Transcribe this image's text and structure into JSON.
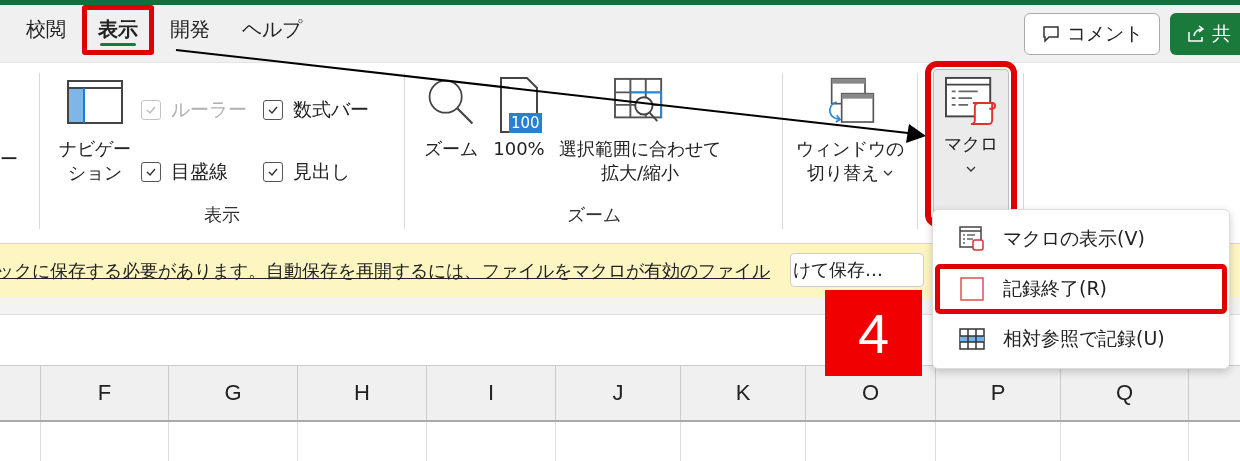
{
  "tabs": [
    {
      "label": "校閲",
      "selected": false,
      "highlighted": false
    },
    {
      "label": "表示",
      "selected": true,
      "highlighted": true
    },
    {
      "label": "開発",
      "selected": false,
      "highlighted": false
    },
    {
      "label": "ヘルプ",
      "selected": false,
      "highlighted": false
    }
  ],
  "header_buttons": [
    {
      "kind": "comment",
      "label": "コメント"
    },
    {
      "kind": "share",
      "label": "共"
    }
  ],
  "ribbon": {
    "cut_label": "ー",
    "show_group": {
      "label": "表示",
      "navigation": {
        "label_lines": [
          "ナビゲー",
          "ション"
        ]
      },
      "checkboxes": [
        {
          "label": "ルーラー",
          "checked": true,
          "disabled": true
        },
        {
          "label": "数式バー",
          "checked": true,
          "disabled": false
        },
        {
          "label": "目盛線",
          "checked": true,
          "disabled": false
        },
        {
          "label": "見出し",
          "checked": true,
          "disabled": false
        }
      ]
    },
    "zoom_group": {
      "label": "ズーム",
      "buttons": [
        {
          "kind": "zoom",
          "label_lines": [
            "ズーム"
          ]
        },
        {
          "kind": "hundred",
          "icon_text": "100",
          "label_lines": [
            "100%"
          ]
        },
        {
          "kind": "fit",
          "label_lines": [
            "選択範囲に合わせて",
            "拡大/縮小"
          ]
        }
      ]
    },
    "window_switch": {
      "label_lines": [
        "ウィンドウの",
        "切り替え"
      ]
    },
    "macro": {
      "label": "マクロ",
      "highlighted": true
    }
  },
  "message_bar": {
    "text": "ックに保存する必要があります。自動保存を再開するには、ファイルをマクロが有効のファイル",
    "button": "けて保存…"
  },
  "columns": [
    "F",
    "G",
    "H",
    "I",
    "J",
    "K",
    "O",
    "P",
    "Q"
  ],
  "macro_menu": [
    {
      "kind": "view",
      "label": "マクロの表示(V)",
      "highlighted": false
    },
    {
      "kind": "stop",
      "label": "記録終了(R)",
      "highlighted": true
    },
    {
      "kind": "relative",
      "label": "相対参照で記録(U)",
      "highlighted": false
    }
  ],
  "step_badge": "4"
}
